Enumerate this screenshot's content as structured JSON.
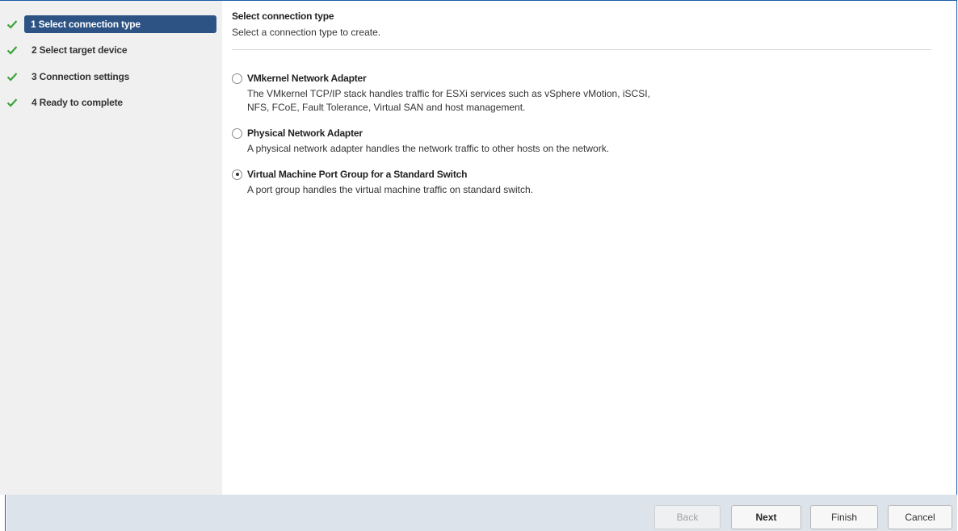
{
  "wizard": {
    "steps": [
      {
        "label": "1  Select connection type",
        "done": true,
        "active": true
      },
      {
        "label": "2  Select target device",
        "done": true,
        "active": false
      },
      {
        "label": "3  Connection settings",
        "done": true,
        "active": false
      },
      {
        "label": "4  Ready to complete",
        "done": true,
        "active": false
      }
    ],
    "colors": {
      "check": "#3aa43a",
      "active_bg": "#2c5384",
      "border_accent": "#1a5aa8"
    }
  },
  "main": {
    "title": "Select connection type",
    "subtitle": "Select a connection type to create.",
    "options": [
      {
        "title": "VMkernel Network Adapter",
        "description_lines": [
          "The VMkernel TCP/IP stack handles traffic for  ESXi services such as vSphere vMotion, iSCSI,",
          "NFS, FCoE, Fault Tolerance, Virtual SAN and host management."
        ],
        "selected": false
      },
      {
        "title": "Physical Network Adapter",
        "description_lines": [
          "A physical network adapter handles the network traffic to other hosts on the network."
        ],
        "selected": false
      },
      {
        "title": "Virtual Machine Port Group for a Standard Switch",
        "description_lines": [
          "A port group handles the virtual machine traffic on standard switch."
        ],
        "selected": true
      }
    ]
  },
  "footer": {
    "back_label": "Back",
    "next_label": "Next",
    "finish_label": "Finish",
    "cancel_label": "Cancel"
  }
}
